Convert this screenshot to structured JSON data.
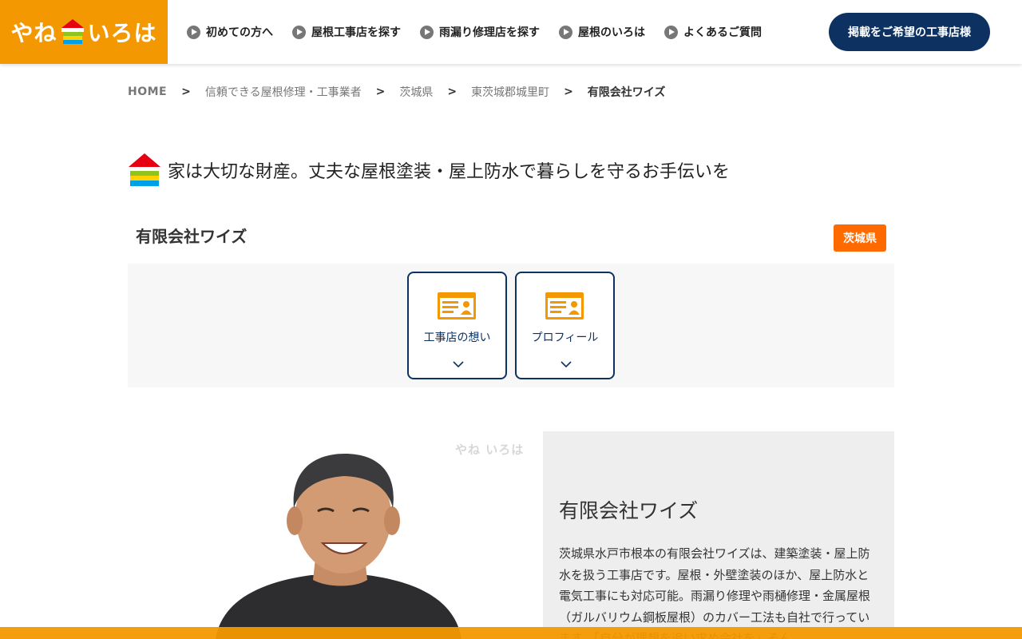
{
  "header": {
    "logo_left": "やね",
    "logo_right": "いろは",
    "nav": [
      {
        "label": "初めての方へ"
      },
      {
        "label": "屋根工事店を探す"
      },
      {
        "label": "雨漏り修理店を探す"
      },
      {
        "label": "屋根のいろは"
      },
      {
        "label": "よくあるご質問"
      }
    ],
    "cta_label": "掲載をご希望の工事店様"
  },
  "breadcrumb": {
    "home": "HOME",
    "level1": "信頼できる屋根修理・工事業者",
    "level2": "茨城県",
    "level3": "東茨城郡城里町",
    "current": "有限会社ワイズ",
    "separator": ">"
  },
  "tagline": "家は大切な財産。丈夫な屋根塗装・屋上防水で暮らしを守るお手伝いを",
  "company": {
    "name": "有限会社ワイズ",
    "prefecture": "茨城県"
  },
  "tabs": [
    {
      "label": "工事店の想い",
      "icon": "profile-card-icon"
    },
    {
      "label": "プロフィール",
      "icon": "profile-card-icon"
    }
  ],
  "intro": {
    "watermark": "やね いろは",
    "title": "有限会社ワイズ",
    "description": "茨城県水戸市根本の有限会社ワイズは、建築塗装・屋上防水を扱う工事店です。屋根・外壁塗装のほか、屋上防水と電気工事にも対応可能。雨漏り修理や雨樋修理・金属屋根（ガルバリウム鋼板屋根）のカバー工法も自社で行っています。「自分が理想を追い求め会社を」そん"
  },
  "colors": {
    "brand_orange": "#f39800",
    "navy": "#0d3261",
    "badge_orange": "#ff6a00"
  }
}
